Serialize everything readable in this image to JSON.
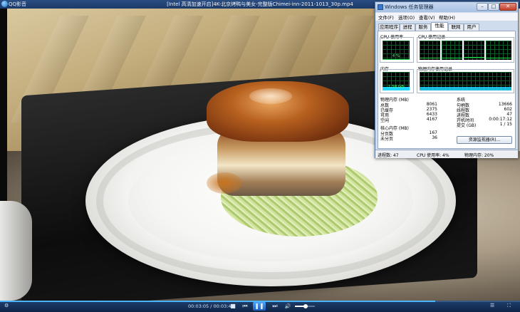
{
  "player": {
    "app_name": "QQ影音",
    "video_title": "[Intel 高清加速开启]4K-北京烤鸭与美女-完整版Chimei-inn-2011-1013_30p.mp4",
    "time_current": "00:03:05",
    "time_total": "00:03:41",
    "time_display": "00:03:05 / 00:03:41",
    "progress": 0.837,
    "volume": 0.55,
    "controls": {
      "stop_icon": "■",
      "prev_icon": "⏮",
      "play_pause_icon": "❚❚",
      "next_icon": "⏭",
      "mute_icon": "🔊",
      "fullscreen_icon": "⛶",
      "playlist_icon": "☰",
      "settings_icon": "⚙"
    }
  },
  "taskmgr": {
    "title": "Windows 任务管理器",
    "controls": {
      "minimize": "–",
      "maximize": "□",
      "close": "✕"
    },
    "menu": [
      "文件(F)",
      "选项(O)",
      "查看(V)",
      "帮助(H)"
    ],
    "tabs": [
      "应用程序",
      "进程",
      "服务",
      "性能",
      "联网",
      "用户"
    ],
    "active_tab": "性能",
    "cpu_usage_label": "CPU 使用率",
    "cpu_usage_value": "4 %",
    "cpu_usage_fraction": 0.04,
    "cpu_history_label": "CPU 使用记录",
    "memory_label": "内存",
    "memory_value": "1.58 GB",
    "memory_fraction": 0.2,
    "memory_history_label": "物理内存使用记录",
    "physical_memory": {
      "heading": "物理内存 (MB)",
      "rows": [
        {
          "k": "总数",
          "v": "8061"
        },
        {
          "k": "已缓存",
          "v": "2375"
        },
        {
          "k": "可用",
          "v": "6433"
        },
        {
          "k": "空闲",
          "v": "4167"
        }
      ]
    },
    "system": {
      "heading": "系统",
      "rows": [
        {
          "k": "句柄数",
          "v": "13666"
        },
        {
          "k": "线程数",
          "v": "602"
        },
        {
          "k": "进程数",
          "v": "47"
        },
        {
          "k": "开机时间",
          "v": "0:00:17:12"
        },
        {
          "k": "提交 (GB)",
          "v": "1 / 15"
        }
      ]
    },
    "kernel_memory": {
      "heading": "核心内存 (MB)",
      "rows": [
        {
          "k": "分页数",
          "v": "167"
        },
        {
          "k": "未分页",
          "v": "36"
        }
      ]
    },
    "resmon_button": "资源监视器(R)...",
    "status": {
      "processes": "进程数: 47",
      "cpu": "CPU 使用率: 4%",
      "memory": "物理内存: 20%"
    }
  },
  "colors": {
    "graph_green": "#1fe04a",
    "memory_cyan": "#1fd7ff",
    "player_blue": "#1f3f6d",
    "accent": "#4bb4ff"
  }
}
